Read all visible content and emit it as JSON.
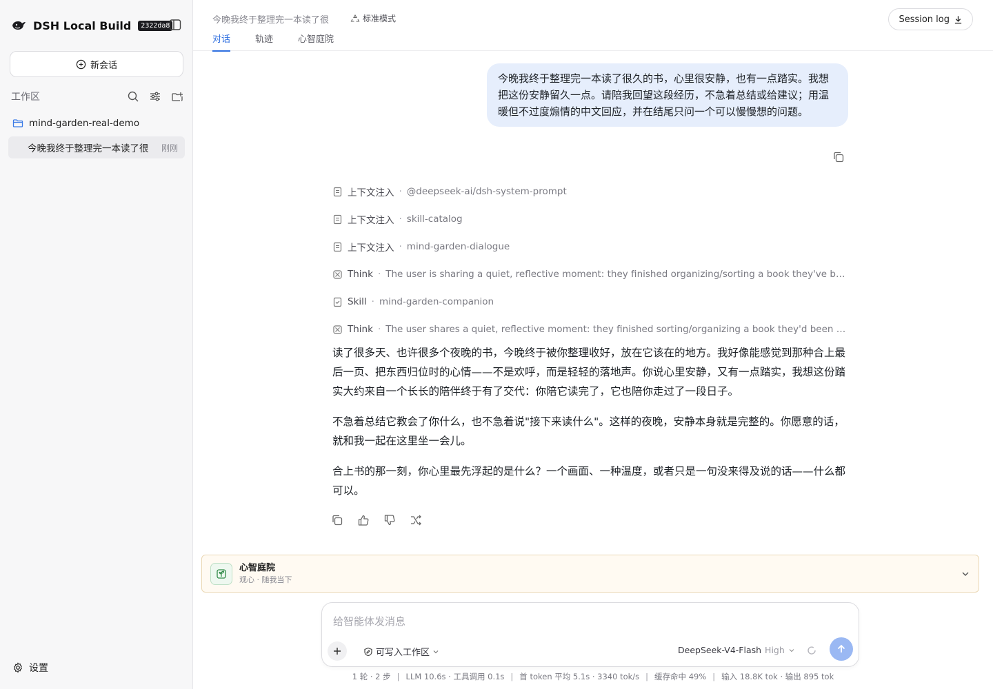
{
  "app": {
    "name": "DSH Local Build",
    "build": "2322da8"
  },
  "sidebar": {
    "new_chat_label": "新会话",
    "workspace_title": "工作区",
    "folder_name": "mind-garden-real-demo",
    "session": {
      "title": "今晚我终于整理完一本读了很",
      "time": "刚刚"
    },
    "settings_label": "设置"
  },
  "header": {
    "title": "今晚我终于整理完一本读了很",
    "mode": "标准模式",
    "tabs": [
      "对话",
      "轨迹",
      "心智庭院"
    ],
    "active_tab": "对话",
    "session_log_label": "Session log"
  },
  "conversation": {
    "user_message": "今晚我终于整理完一本读了很久的书，心里很安静，也有一点踏实。我想把这份安静留久一点。请陪我回望这段经历，不急着总结或给建议；用温暖但不过度煽情的中文回应，并在结尾只问一个可以慢慢想的问题。",
    "trace": [
      {
        "icon": "document-icon",
        "kind": "上下文注入",
        "detail": "@deepseek-ai/dsh-system-prompt"
      },
      {
        "icon": "document-icon",
        "kind": "上下文注入",
        "detail": "skill-catalog"
      },
      {
        "icon": "document-icon",
        "kind": "上下文注入",
        "detail": "mind-garden-dialogue"
      },
      {
        "icon": "think-icon",
        "kind": "Think",
        "detail": "The user is sharing a quiet, reflective moment: they finished organizing/sorting a book they've been readin..."
      },
      {
        "icon": "skill-icon",
        "kind": "Skill",
        "detail": "mind-garden-companion"
      },
      {
        "icon": "think-icon",
        "kind": "Think",
        "detail": "The user shares a quiet, reflective moment: they finished sorting/organizing a book they'd been reading for ..."
      }
    ],
    "assistant_paragraphs": [
      "读了很多天、也许很多个夜晚的书，今晚终于被你整理收好，放在它该在的地方。我好像能感觉到那种合上最后一页、把东西归位时的心情——不是欢呼，而是轻轻的落地声。你说心里安静，又有一点踏实，我想这份踏实大约来自一个长长的陪伴终于有了交代：你陪它读完了，它也陪你走过了一段日子。",
      "不急着总结它教会了你什么，也不急着说\"接下来读什么\"。这样的夜晚，安静本身就是完整的。你愿意的话，就和我一起在这里坐一会儿。",
      "合上书的那一刻，你心里最先浮起的是什么？一个画面、一种温度，或者只是一句没来得及说的话——什么都可以。"
    ]
  },
  "garden_panel": {
    "title": "心智庭院",
    "subtitle": "观心 · 随我当下"
  },
  "composer": {
    "placeholder": "给智能体发消息",
    "permission_label": "可写入工作区",
    "model_name": "DeepSeek-V4-Flash",
    "model_level": "High"
  },
  "stats": {
    "turns": "1 轮 · 2 步",
    "llm": "LLM 10.6s · 工具调用 0.1s",
    "first_token": "首 token 平均 5.1s · 3340 tok/s",
    "cache": "缓存命中 49%",
    "io": "输入 18.8K tok · 输出 895 tok"
  },
  "colors": {
    "accent": "#2f6fe0",
    "user_bubble": "#e6eefc",
    "panel_bg": "#fffaf2",
    "send_button": "#9ab8f3"
  }
}
